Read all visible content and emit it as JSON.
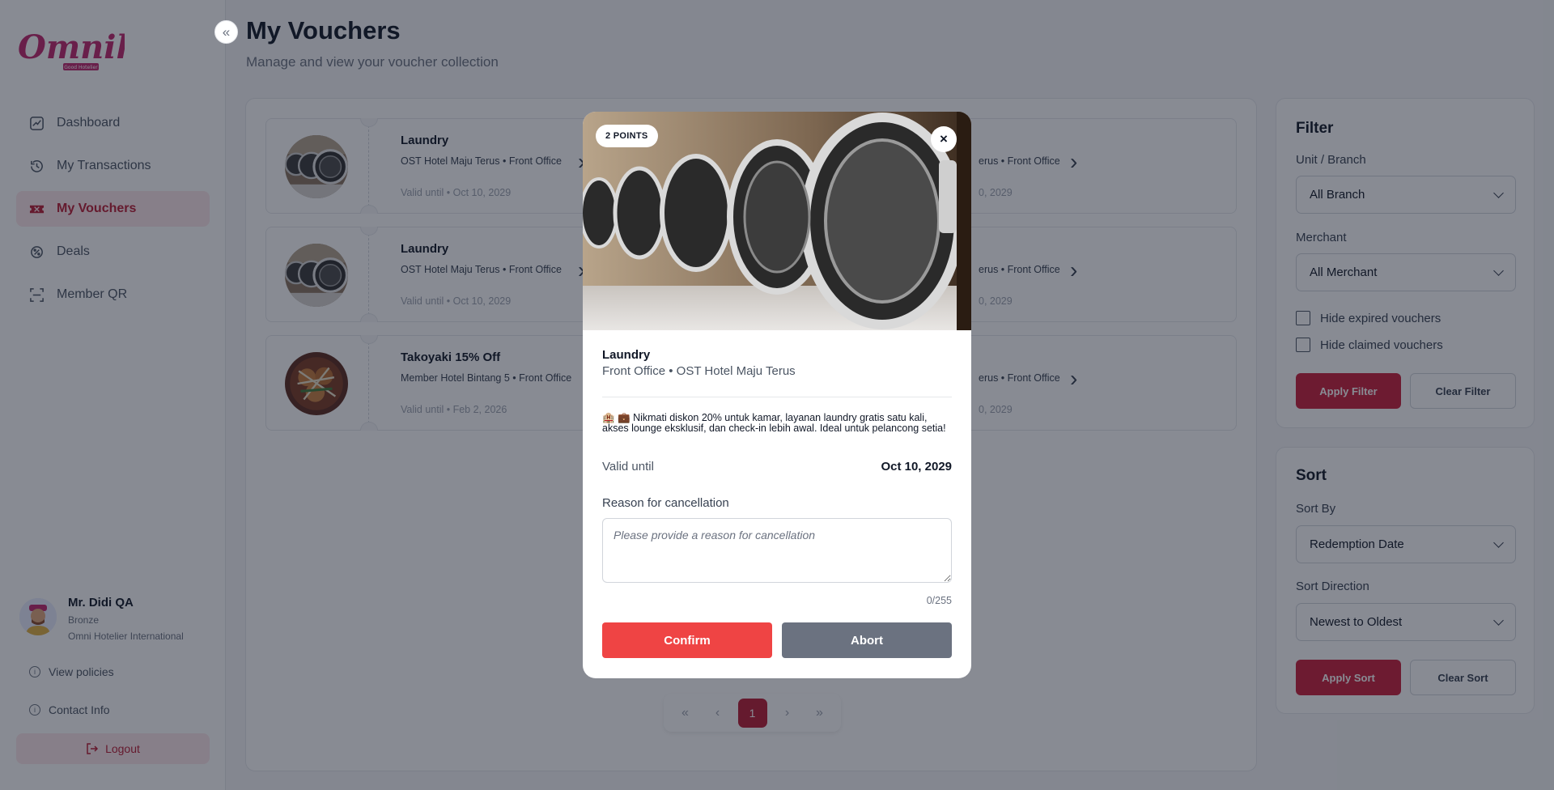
{
  "brand": {
    "name": "Omnih",
    "tagline": "Good Hotelier"
  },
  "colors": {
    "accent": "#c81e3a",
    "confirm": "#ef4444",
    "abort": "#6b7280"
  },
  "sidebar": {
    "items": [
      {
        "label": "Dashboard",
        "icon": "chart-line-icon",
        "active": false
      },
      {
        "label": "My Transactions",
        "icon": "history-icon",
        "active": false
      },
      {
        "label": "My Vouchers",
        "icon": "ticket-icon",
        "active": true
      },
      {
        "label": "Deals",
        "icon": "tag-icon",
        "active": false
      },
      {
        "label": "Member QR",
        "icon": "qr-scan-icon",
        "active": false
      }
    ],
    "user": {
      "name": "Mr. Didi QA",
      "tier": "Bronze",
      "organization": "Omni Hotelier International"
    },
    "view_policies": "View policies",
    "contact_info": "Contact Info",
    "logout": "Logout"
  },
  "page": {
    "title": "My Vouchers",
    "subtitle": "Manage and view your voucher collection"
  },
  "vouchers": [
    {
      "title": "Laundry",
      "subtitle": "OST Hotel Maju Terus • Front Office",
      "valid": "Valid until • Oct 10, 2029",
      "image": "laundry"
    },
    {
      "title": "Laundry",
      "subtitle": "OST Hotel Maju Terus • Front Office",
      "valid": "Valid until • Oct 10, 2029",
      "image": "laundry"
    },
    {
      "title": "Takoyaki 15% Off",
      "subtitle": "Member Hotel Bintang 5 • Front Office",
      "valid": "Valid until • Feb 2, 2026",
      "image": "takoyaki"
    }
  ],
  "vouchers_right": [
    {
      "subtitle_fragment": "erus • Front Office",
      "valid_fragment": "0, 2029"
    },
    {
      "subtitle_fragment": "erus • Front Office",
      "valid_fragment": "0, 2029"
    },
    {
      "subtitle_fragment": "erus • Front Office",
      "valid_fragment": "0, 2029"
    }
  ],
  "pagination": {
    "first": "«",
    "prev": "‹",
    "current": "1",
    "next": "›",
    "last": "»"
  },
  "filter": {
    "title": "Filter",
    "unit_label": "Unit / Branch",
    "unit_value": "All Branch",
    "merchant_label": "Merchant",
    "merchant_value": "All Merchant",
    "hide_expired": "Hide expired vouchers",
    "hide_claimed": "Hide claimed vouchers",
    "apply": "Apply Filter",
    "clear": "Clear Filter"
  },
  "sort": {
    "title": "Sort",
    "by_label": "Sort By",
    "by_value": "Redemption Date",
    "direction_label": "Sort Direction",
    "direction_value": "Newest to Oldest",
    "apply": "Apply Sort",
    "clear": "Clear Sort"
  },
  "modal": {
    "points": "2 POINTS",
    "close": "×",
    "title": "Laundry",
    "subtitle": "Front Office • OST Hotel Maju Terus",
    "description": "🏨 💼 Nikmati diskon 20% untuk kamar, layanan laundry gratis satu kali, akses lounge eksklusif, dan check-in lebih awal. Ideal untuk pelancong setia!",
    "valid_label": "Valid until",
    "valid_date": "Oct 10, 2029",
    "reason_label": "Reason for cancellation",
    "reason_placeholder": "Please provide a reason for cancellation",
    "reason_value": "",
    "counter": "0/255",
    "confirm": "Confirm",
    "abort": "Abort"
  }
}
